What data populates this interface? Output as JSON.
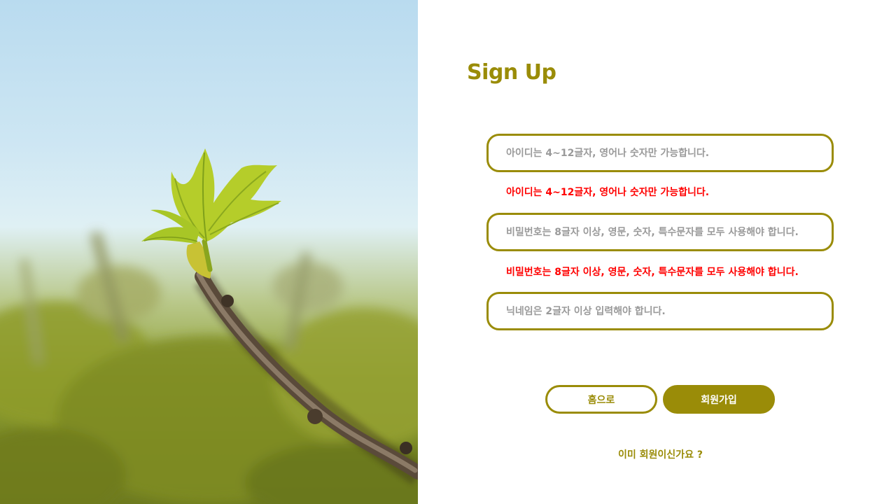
{
  "colors": {
    "accent": "#9a8c08",
    "error": "#ff0000",
    "placeholder": "#9a9a9a",
    "background": "#ffffff"
  },
  "hero": {
    "icon": "fig-leaf-branch-photo"
  },
  "form": {
    "title": "Sign Up",
    "id_field": {
      "placeholder": "아이디는 4~12글자, 영어나 숫자만 가능합니다.",
      "value": "",
      "error": "아이디는 4~12글자, 영어나 숫자만 가능합니다."
    },
    "password_field": {
      "placeholder": "비밀번호는 8글자 이상, 영문, 숫자, 특수문자를 모두 사용해야 합니다.",
      "value": "",
      "error": "비밀번호는 8글자 이상, 영문, 숫자, 특수문자를 모두 사용해야 합니다."
    },
    "nickname_field": {
      "placeholder": "닉네임은 2글자 이상 입력해야 합니다.",
      "value": ""
    },
    "home_button": "홈으로",
    "signup_button": "회원가입",
    "login_link": "이미 회원이신가요 ?"
  }
}
